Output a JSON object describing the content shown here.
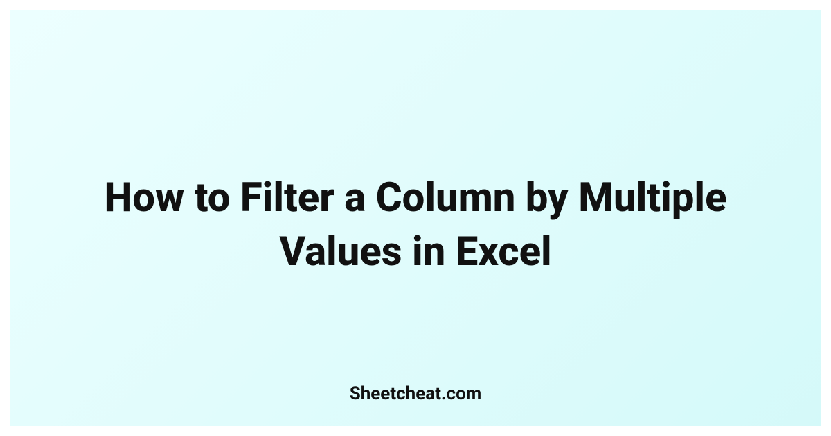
{
  "title": "How to Filter a Column by Multiple Values in Excel",
  "footer": "Sheetcheat.com"
}
